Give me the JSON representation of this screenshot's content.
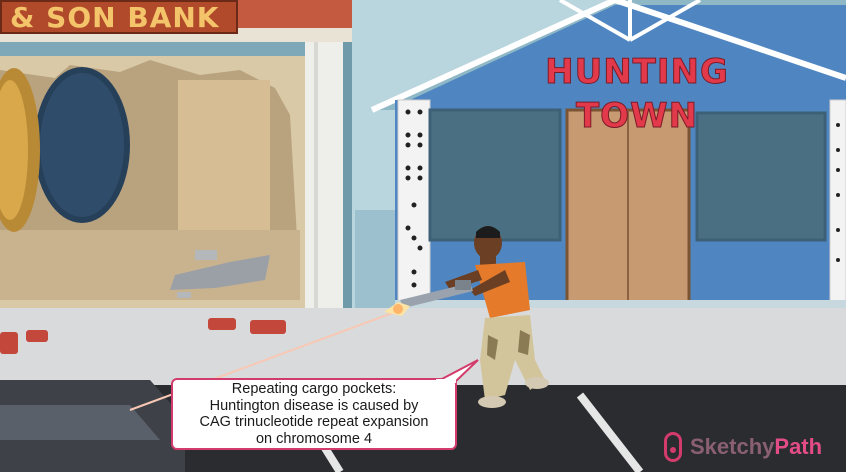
{
  "scene": {
    "bank_sign_text": "& SON BANK",
    "shop_sign_text": "HUNTING TOWN"
  },
  "caption": {
    "lines": [
      "Repeating cargo pockets:",
      "Huntington disease is caused by",
      "CAG trinucleotide repeat expansion",
      "on chromosome 4"
    ]
  },
  "logo": {
    "prefix": "Sketchy",
    "brand": "Path"
  },
  "colors": {
    "caption_border": "#d23b6b",
    "shop_wall": "#4f86c2",
    "bank_wall": "#c0523a",
    "logo_accent": "#e34c86"
  }
}
